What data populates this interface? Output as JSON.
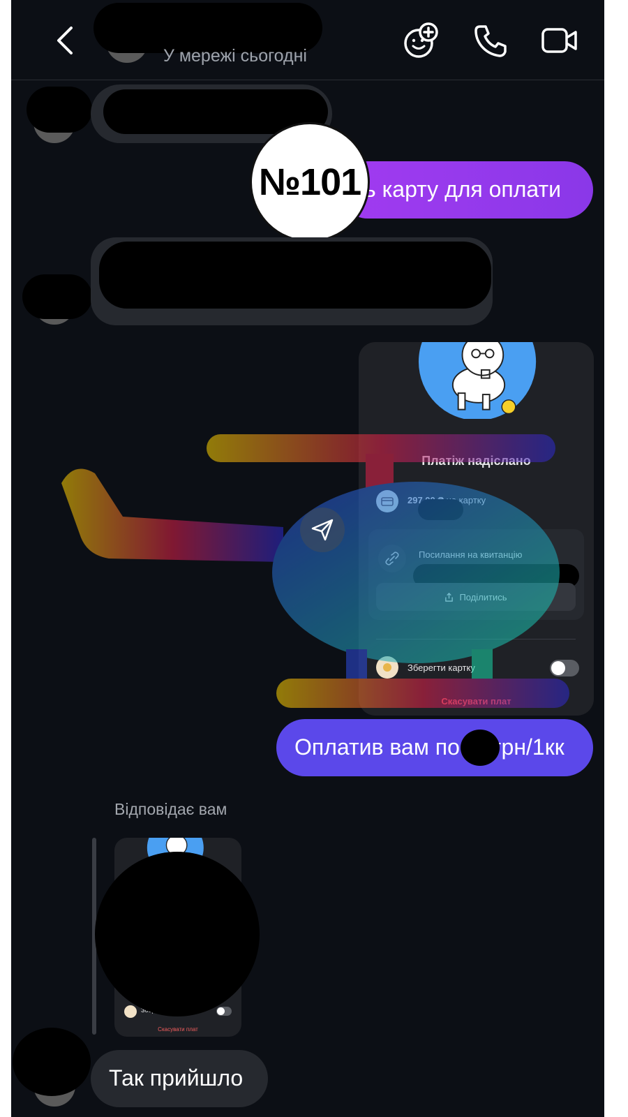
{
  "header": {
    "status": "У мережі сьогодні",
    "icons": [
      "back-icon",
      "add-emoji-icon",
      "phone-icon",
      "video-icon"
    ]
  },
  "stamp": {
    "label": "№101"
  },
  "messages": {
    "outgoing_1": "ь карту для оплати",
    "outgoing_2": "Оплатив вам по",
    "outgoing_2_suffix": "грн/1кк",
    "incoming_last": "Так прийшло"
  },
  "receipt": {
    "title": "Платіж надіслано",
    "amount": "297.00 ₴",
    "amount_suffix": " на картку",
    "link_label": "Посилання на квитанцію",
    "share_label": "Поділитись",
    "save_card_label": "Зберегти картку",
    "cancel_label": "Скасувати плат"
  },
  "reply": {
    "label": "Відповідає вам",
    "mini_save_label": "Збер",
    "mini_cancel_label": "Скасувати плат"
  },
  "colors": {
    "background": "#0c0f15",
    "incoming_bubble": "#26292f",
    "outgoing_purple": "#8a38e8",
    "outgoing_blue": "#5b48ea",
    "danger": "#ef5d5d"
  }
}
